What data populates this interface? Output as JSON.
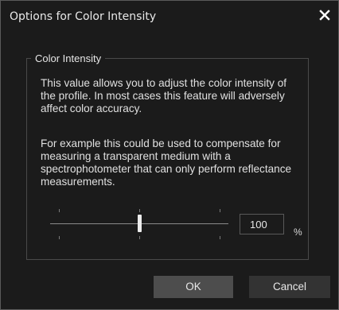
{
  "window": {
    "title": "Options for Color Intensity",
    "close_icon": "close-icon"
  },
  "group": {
    "legend": "Color Intensity",
    "description_1": "This value allows you to adjust the color intensity of the profile. In most cases this feature will adversely affect color accuracy.",
    "description_2": "For example this could be used to compensate for measuring a transparent medium with a spectrophotometer that can only perform reflectance measurements."
  },
  "intensity": {
    "value": "100",
    "unit": "%",
    "slider_position_fraction": 0.5
  },
  "buttons": {
    "ok": "OK",
    "cancel": "Cancel"
  },
  "colors": {
    "background": "#1b1b1b",
    "ok_button": "#4d4d4d",
    "cancel_button": "#333333"
  }
}
